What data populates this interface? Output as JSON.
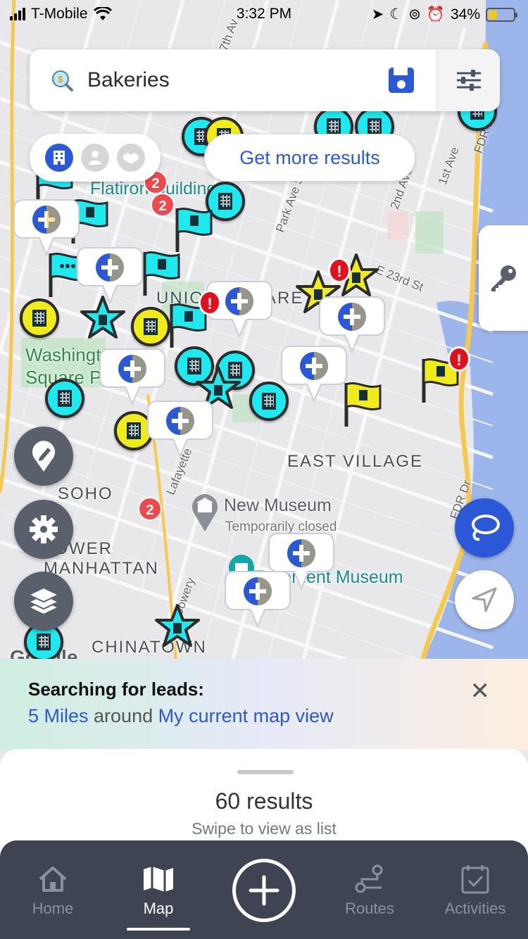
{
  "status_bar": {
    "carrier": "T-Mobile",
    "time": "3:32 PM",
    "battery": "34%",
    "battery_level": 0.34
  },
  "search": {
    "query": "Bakeries",
    "search_icon": "search-dollar-icon",
    "save_icon": "floppy-save-icon",
    "filter_icon": "sliders-icon"
  },
  "type_toggle": {
    "items": [
      "building-icon",
      "person-icon",
      "handshake-icon"
    ],
    "active": 0
  },
  "more_results": "Get more results",
  "map": {
    "labels": {
      "flatiron": "Flatiron Building",
      "washington": "Washington\nSquare Park",
      "union": "UNION SQUARE",
      "east_village": "EAST VILLAGE",
      "soho": "SOHO",
      "lower_manhattan": "LOWER\nMANHATTAN",
      "chinatown": "CHINATOWN",
      "new_museum": "New Museum",
      "new_museum_status": "Temporarily closed",
      "tenement": "Tenement Museum",
      "e23": "E 23rd St",
      "fdr": "FDR Dr",
      "fdr2": "FDR Dr",
      "first_ave": "1st Ave",
      "second_ave": "2nd Ave",
      "park_ave": "Park Ave S",
      "lafayette": "Lafayette",
      "bowery": "Bowery",
      "seventh_ave": "7th Av",
      "google": "Google"
    },
    "badges": [
      "2",
      "2",
      "2"
    ]
  },
  "side_buttons": {
    "key": "key-icon",
    "edit": "pin-edit-icon",
    "settings": "gear-icon",
    "layers": "layers-icon",
    "lasso": "lasso-icon",
    "locate": "navigation-arrow-icon"
  },
  "banner": {
    "title": "Searching for leads:",
    "distance": "5 Miles",
    "around": " around ",
    "area": "My current map view",
    "close": "✕"
  },
  "sheet": {
    "count": "60 results",
    "hint": "Swipe to view as list"
  },
  "tabbar": {
    "home": "Home",
    "map": "Map",
    "routes": "Routes",
    "activities": "Activities",
    "active": "Map"
  }
}
